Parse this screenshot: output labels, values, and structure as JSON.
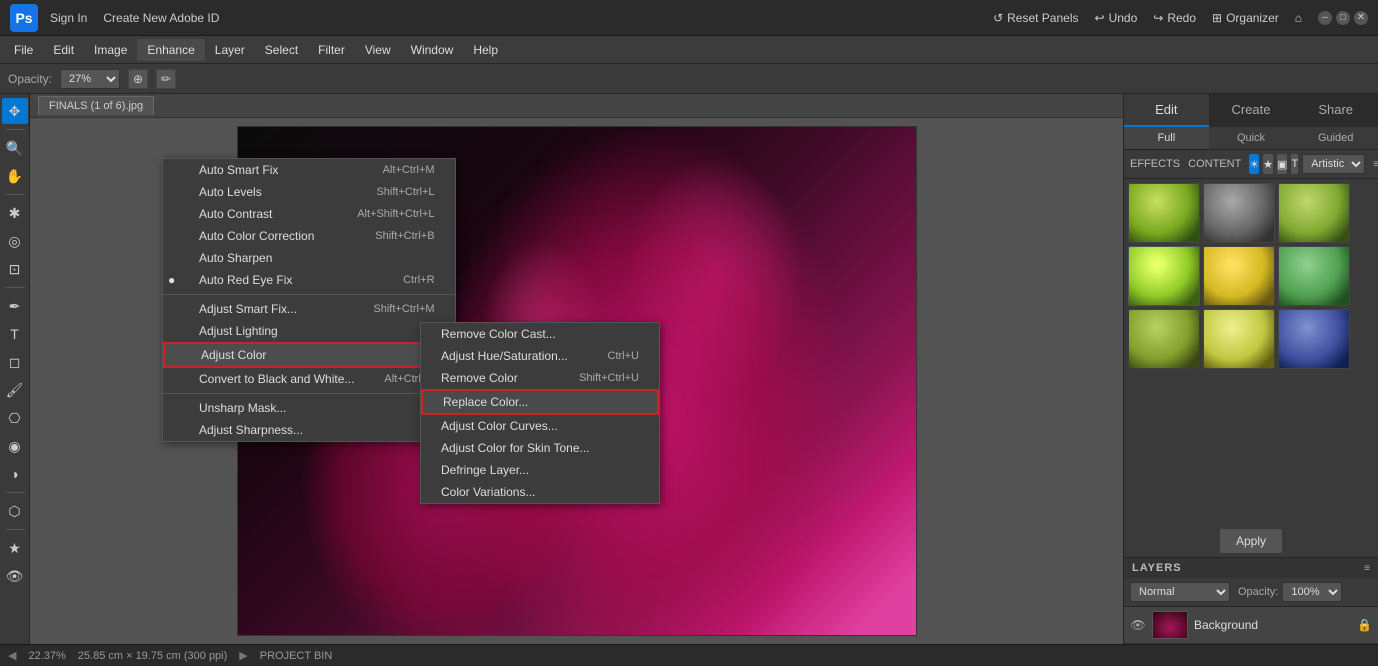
{
  "app": {
    "title": "Adobe Photoshop Elements",
    "logo": "Ps"
  },
  "topbar": {
    "sign_in": "Sign In",
    "create_id": "Create New Adobe ID",
    "reset_panels": "Reset Panels",
    "undo": "Undo",
    "redo": "Redo",
    "organizer": "Organizer"
  },
  "menubar": {
    "items": [
      "File",
      "Edit",
      "Image",
      "Enhance",
      "Layer",
      "Select",
      "Filter",
      "View",
      "Window",
      "Help"
    ]
  },
  "toolbar": {
    "opacity_label": "Opacity:",
    "opacity_value": "27%"
  },
  "enhance_menu": {
    "items": [
      {
        "label": "Auto Smart Fix",
        "shortcut": "Alt+Ctrl+M",
        "has_icon": false
      },
      {
        "label": "Auto Levels",
        "shortcut": "Shift+Ctrl+L",
        "has_icon": false
      },
      {
        "label": "Auto Contrast",
        "shortcut": "Alt+Shift+Ctrl+L",
        "has_icon": false
      },
      {
        "label": "Auto Color Correction",
        "shortcut": "Shift+Ctrl+B",
        "has_icon": false
      },
      {
        "label": "Auto Sharpen",
        "shortcut": "",
        "has_icon": false
      },
      {
        "label": "Auto Red Eye Fix",
        "shortcut": "Ctrl+R",
        "has_check": true
      },
      {
        "separator": true
      },
      {
        "label": "Adjust Smart Fix...",
        "shortcut": "Shift+Ctrl+M",
        "has_icon": false
      },
      {
        "label": "Adjust Lighting",
        "shortcut": "",
        "has_submenu": true
      },
      {
        "label": "Adjust Color",
        "shortcut": "",
        "has_submenu": true,
        "active": true
      },
      {
        "label": "Convert to Black and White...",
        "shortcut": "Alt+Ctrl+B",
        "has_icon": false
      },
      {
        "separator": true
      },
      {
        "label": "Unsharp Mask...",
        "shortcut": "",
        "has_icon": false
      },
      {
        "label": "Adjust Sharpness...",
        "shortcut": "",
        "has_icon": false
      }
    ]
  },
  "adjust_color_menu": {
    "items": [
      {
        "label": "Remove Color Cast...",
        "shortcut": ""
      },
      {
        "label": "Adjust Hue/Saturation...",
        "shortcut": "Ctrl+U"
      },
      {
        "label": "Remove Color",
        "shortcut": "Shift+Ctrl+U"
      },
      {
        "label": "Replace Color...",
        "shortcut": "",
        "highlighted": true
      },
      {
        "label": "Adjust Color Curves...",
        "shortcut": ""
      },
      {
        "label": "Adjust Color for Skin Tone...",
        "shortcut": ""
      },
      {
        "label": "Defringe Layer...",
        "shortcut": ""
      },
      {
        "label": "Color Variations...",
        "shortcut": ""
      }
    ]
  },
  "right_panel": {
    "tabs": [
      "Edit",
      "Create",
      "Share"
    ],
    "active_tab": "Edit",
    "mode_tabs": [
      "Full",
      "Quick",
      "Guided"
    ],
    "active_mode": "Full",
    "effects_label": "EFFECTS",
    "content_label": "CONTENT",
    "style_options": [
      "Artistic"
    ],
    "apply_label": "Apply"
  },
  "layers_panel": {
    "title": "LAYERS",
    "blend_mode": "Normal",
    "opacity_label": "Opacity:",
    "opacity_value": "100%",
    "layers": [
      {
        "name": "Background",
        "visible": true,
        "locked": true
      }
    ]
  },
  "statusbar": {
    "zoom": "22.37%",
    "dimensions": "25.85 cm × 19.75 cm (300 ppi)"
  }
}
